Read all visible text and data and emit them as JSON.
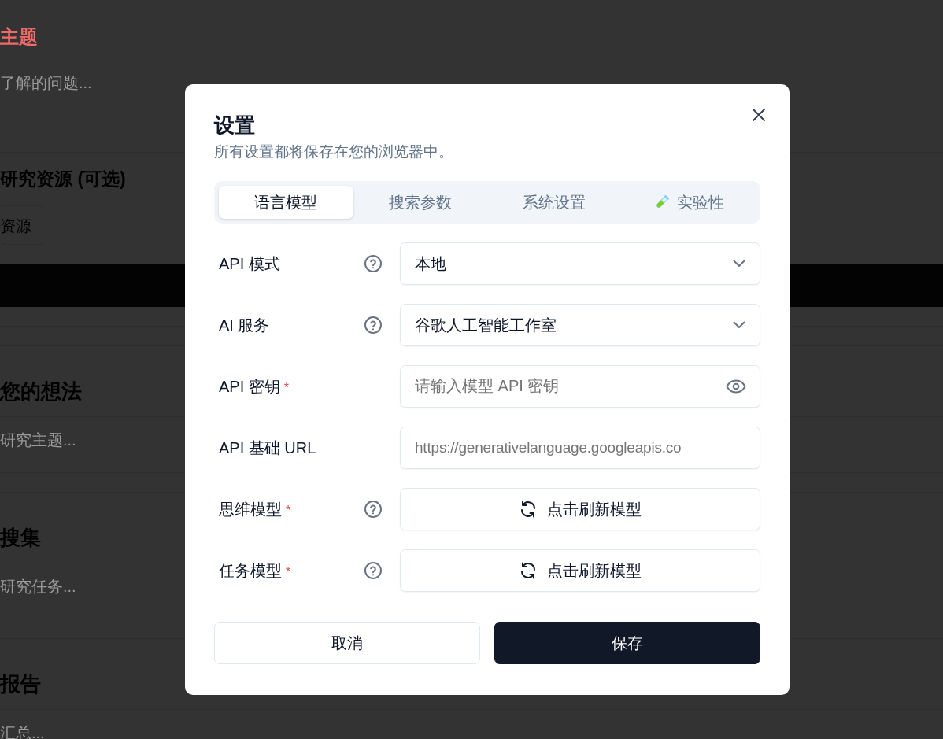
{
  "background_page": {
    "items": [
      {
        "kind": "rule"
      },
      {
        "kind": "title",
        "text": "主题"
      },
      {
        "kind": "rule"
      },
      {
        "kind": "textarea",
        "text": "了解的问题..."
      },
      {
        "kind": "rule"
      },
      {
        "kind": "subheading",
        "text": "研究资源 (可选)"
      },
      {
        "kind": "button",
        "text": "资源"
      },
      {
        "kind": "bar"
      },
      {
        "kind": "rule"
      },
      {
        "kind": "spacer-rule"
      },
      {
        "kind": "heading",
        "text": "您的想法"
      },
      {
        "kind": "rule"
      },
      {
        "kind": "text",
        "text": "研究主题..."
      },
      {
        "kind": "rule"
      },
      {
        "kind": "spacer-rule"
      },
      {
        "kind": "heading",
        "text": "搜集"
      },
      {
        "kind": "rule"
      },
      {
        "kind": "text",
        "text": "研究任务..."
      },
      {
        "kind": "rule"
      },
      {
        "kind": "spacer-rule"
      },
      {
        "kind": "heading",
        "text": "报告"
      },
      {
        "kind": "rule"
      },
      {
        "kind": "text",
        "text": "汇总..."
      }
    ]
  },
  "dialog": {
    "title": "设置",
    "subtitle": "所有设置都将保存在您的浏览器中。",
    "tabs": [
      {
        "label": "语言模型",
        "selected": true,
        "kind": "plain"
      },
      {
        "label": "搜索参数",
        "selected": false,
        "kind": "plain"
      },
      {
        "label": "系统设置",
        "selected": false,
        "kind": "plain"
      },
      {
        "label": "实验性",
        "selected": false,
        "kind": "test-tube"
      }
    ],
    "fields": [
      {
        "label": "API 模式",
        "help": true,
        "kind": "select",
        "value": "本地"
      },
      {
        "label": "AI 服务",
        "help": true,
        "kind": "select",
        "value": "谷歌人工智能工作室"
      },
      {
        "label": "API 密钥",
        "mark": "*",
        "help": false,
        "kind": "password",
        "placeholder": "请输入模型 API 密钥"
      },
      {
        "label": "API 基础 URL",
        "help": false,
        "kind": "text",
        "placeholder": "https://generativelanguage.googleapis.co"
      },
      {
        "label": "思维模型",
        "mark": "*",
        "help": true,
        "kind": "refresh",
        "button": "点击刷新模型"
      },
      {
        "label": "任务模型",
        "mark": "*",
        "help": true,
        "kind": "refresh",
        "button": "点击刷新模型"
      }
    ],
    "buttons": [
      {
        "label": "取消",
        "kind": "secondary"
      },
      {
        "label": "保存",
        "kind": "primary"
      }
    ]
  }
}
